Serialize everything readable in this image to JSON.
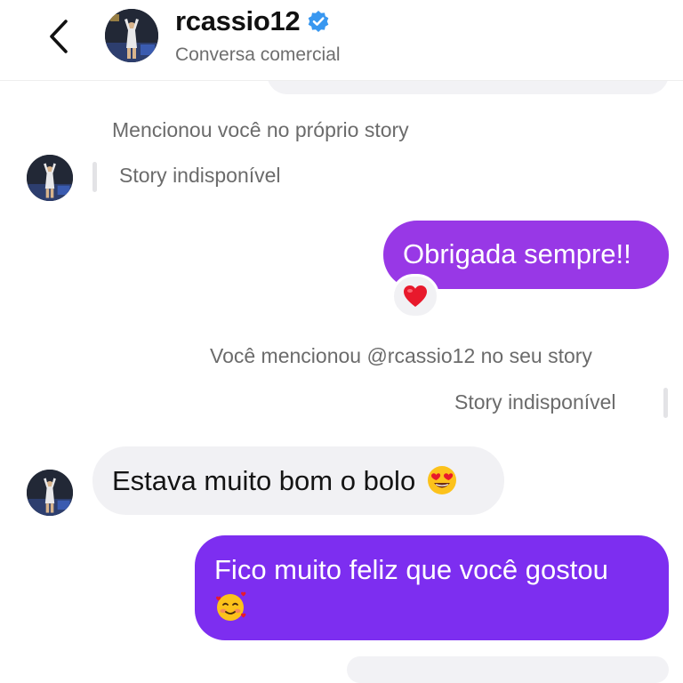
{
  "header": {
    "username": "rcassio12",
    "subtitle": "Conversa comercial",
    "back_icon": "chevron-left-icon",
    "verified_icon": "verified-badge-icon",
    "verified_color": "#3897f0"
  },
  "thread": {
    "mention_received": "Mencionou você no próprio story",
    "story_unavailable_1": "Story indisponível",
    "outgoing_1": "Obrigada sempre!!",
    "reaction_1": "❤️",
    "mention_sent": "Você mencionou @rcassio12 no seu story",
    "story_unavailable_2": "Story indisponível",
    "incoming_1": "Estava muito bom o bolo",
    "incoming_1_emoji": "😍",
    "outgoing_2": "Fico muito feliz que você gostou",
    "outgoing_2_emoji": "🥰"
  },
  "colors": {
    "outgoing_bubble": "#9838e6",
    "outgoing_bubble_2": "#7d2ef0",
    "incoming_bubble": "#f1f1f4",
    "meta_text": "#6b6b6b"
  }
}
